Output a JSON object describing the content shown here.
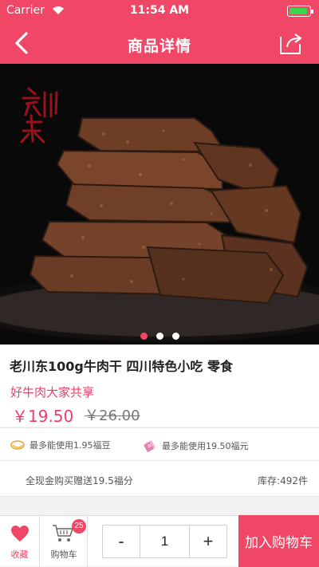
{
  "status_bar": {
    "carrier": "Carrier",
    "time": "11:54 AM",
    "battery_level": 0.9,
    "battery_color": "#38d54f"
  },
  "nav": {
    "title": "商品详情",
    "back_icon": "chevron-left-icon",
    "share_icon": "share-icon"
  },
  "hero": {
    "brand_mark": "老川东",
    "active_slide": 1,
    "slide_count": 3
  },
  "product": {
    "title": "老川东100g牛肉干 四川特色小吃 零食",
    "promo": "好牛肉大家共享",
    "price": "￥19.50",
    "original_price": "￥26.00"
  },
  "benefits": [
    {
      "icon": "gold-coin-icon",
      "label": "最多能使用1.95福豆"
    },
    {
      "icon": "ticket-icon",
      "label": "最多能使用19.50福元"
    }
  ],
  "stock": {
    "bonus": "全现金购买赠送19.5福分",
    "inventory": "库存:492件"
  },
  "bottom_bar": {
    "favorite_label": "收藏",
    "cart_label": "购物车",
    "cart_badge": "25",
    "minus": "-",
    "quantity": "1",
    "plus": "+",
    "add_to_cart": "加入购物车"
  },
  "colors": {
    "primary": "#f04766",
    "price": "#ef3d65",
    "background": "#f2f2f2"
  }
}
